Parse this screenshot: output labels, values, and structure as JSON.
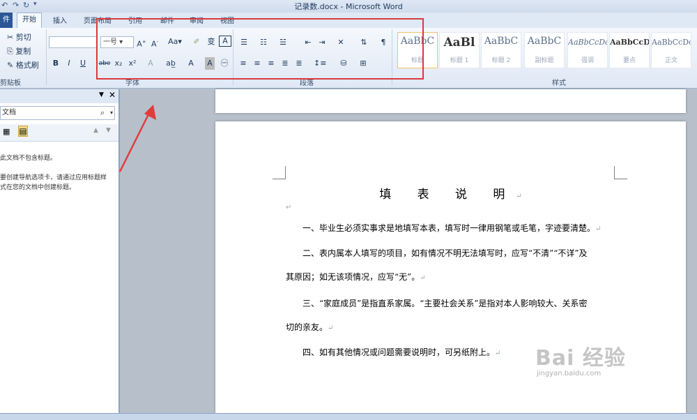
{
  "window": {
    "title": "记录数.docx - Microsoft Word",
    "qat_icons": [
      "undo-icon",
      "redo-icon",
      "customize-icon"
    ]
  },
  "tabs": [
    "件",
    "开始",
    "插入",
    "页面布局",
    "引用",
    "邮件",
    "审阅",
    "视图"
  ],
  "ribbon": {
    "clipboard": {
      "cut": "剪切",
      "copy": "复制",
      "format_painter": "格式刷",
      "label": "剪贴板"
    },
    "font": {
      "font_size": "一号",
      "label": "字体",
      "buttons": [
        "B",
        "I",
        "U",
        "abe",
        "x₂",
        "x²",
        "A",
        "A",
        "A",
        "A"
      ]
    },
    "paragraph": {
      "label": "段落"
    },
    "styles": {
      "label": "样式",
      "items": [
        {
          "sample": "AaBbC",
          "name": "标题"
        },
        {
          "sample": "AaBl",
          "name": "标题 1"
        },
        {
          "sample": "AaBbC",
          "name": "标题 2"
        },
        {
          "sample": "AaBbC",
          "name": "副标题"
        },
        {
          "sample": "AaBbCcDc",
          "name": "强调"
        },
        {
          "sample": "AaBbCcD",
          "name": "要点"
        },
        {
          "sample": "AaBbCcDc",
          "name": "正文"
        }
      ]
    }
  },
  "nav_pane": {
    "search_placeholder": "文档",
    "msg1": "此文档不包含标题。",
    "msg2": "要创建导航选项卡，请通过应用标题样式在您的文档中创建标题。"
  },
  "document": {
    "title": "填 表 说 明",
    "paragraphs": [
      "一、毕业生必须实事求是地填写本表，填写时一律用钢笔或毛笔，字迹要清楚。",
      "二、表内属本人填写的项目，如有情况不明无法填写时，应写“不清”“不详”及",
      "其原因；如无该项情况，应写“无”。",
      "三、“家庭成员”是指直系家属。“主要社会关系”是指对本人影响较大、关系密",
      "切的亲友。",
      "四、如有其他情况或问题需要说明时，可另纸附上。"
    ]
  },
  "watermark": {
    "brand": "Bai 经验",
    "url": "jingyan.baidu.com"
  },
  "colors": {
    "highlight": "#d9393b",
    "ribbon_bg": "#dfe8f5",
    "file_tab": "#2b5797"
  }
}
